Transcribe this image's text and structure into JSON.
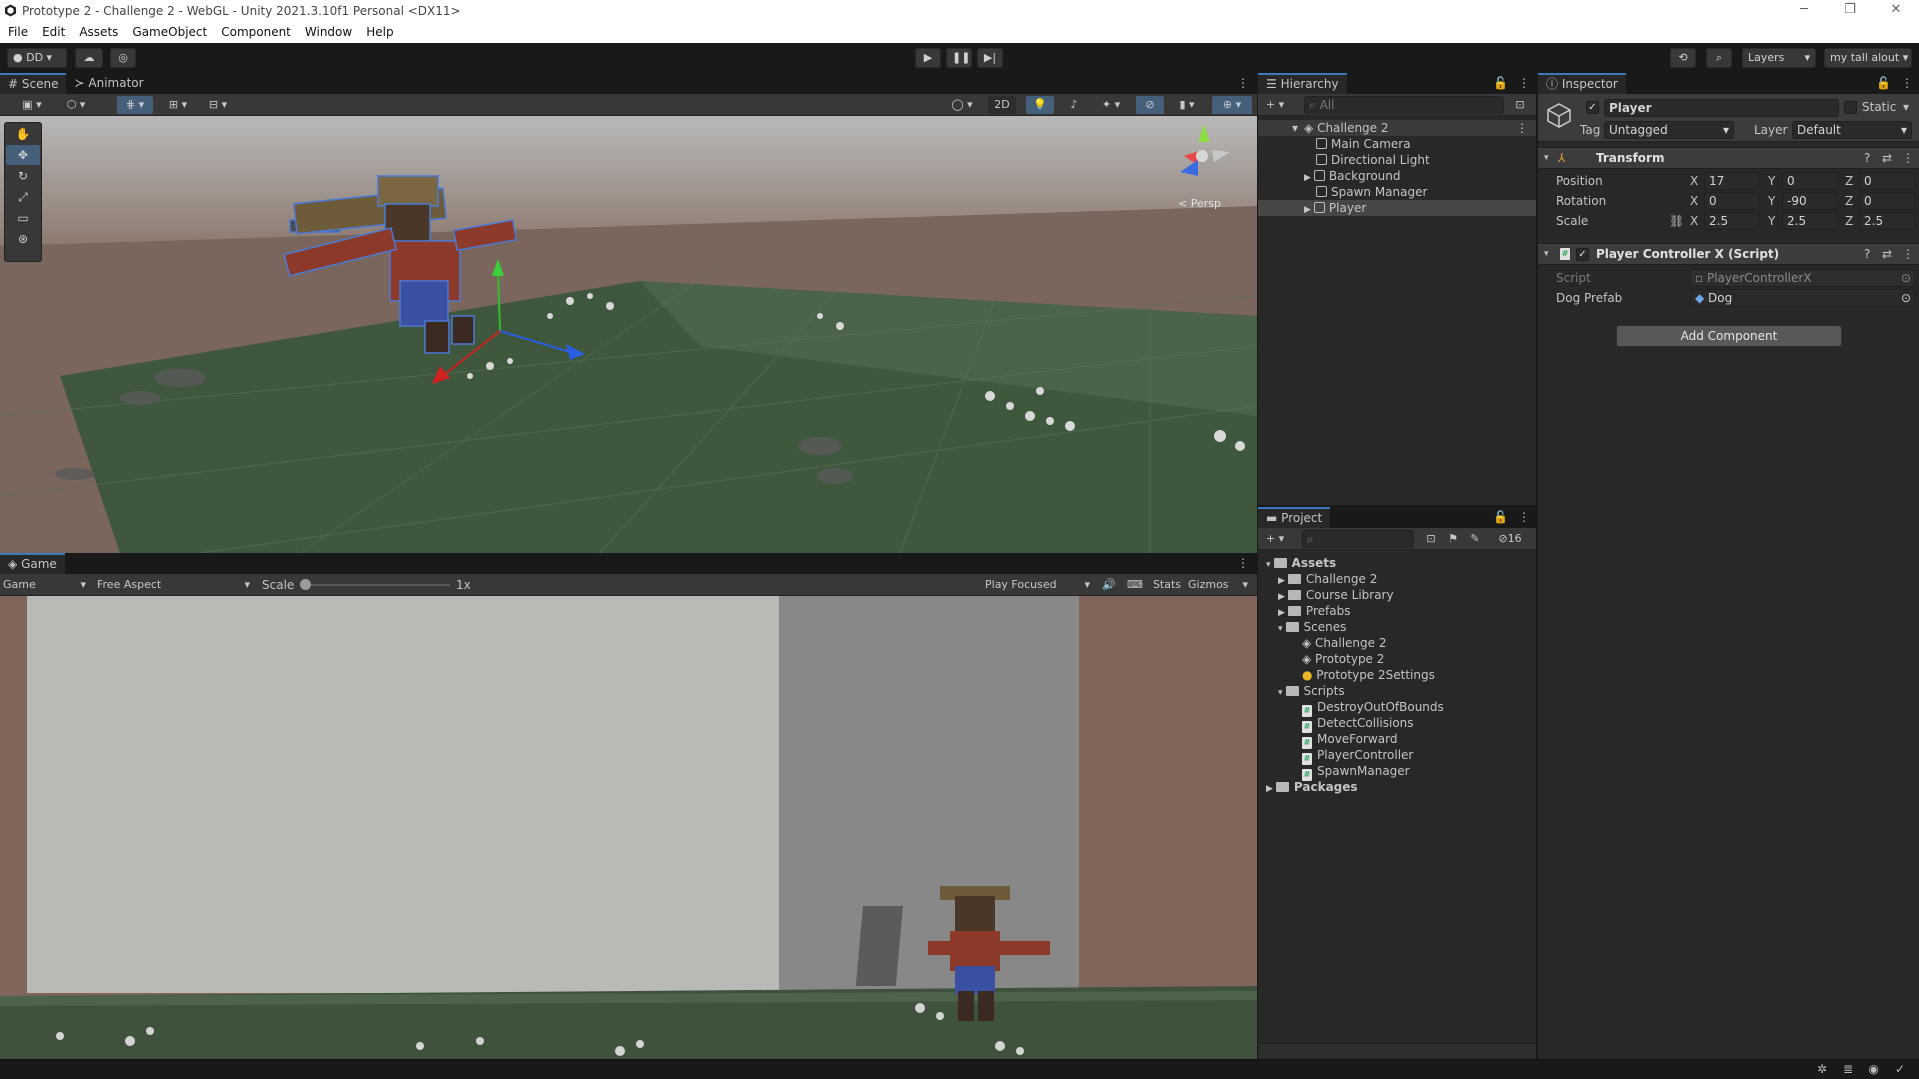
{
  "titlebar": {
    "title": "Prototype 2 - Challenge 2 - WebGL - Unity 2021.3.10f1 Personal <DX11>",
    "minimize": "─",
    "restore": "❐",
    "close": "✕"
  },
  "menu": [
    "File",
    "Edit",
    "Assets",
    "GameObject",
    "Component",
    "Window",
    "Help"
  ],
  "toolbar": {
    "account": "DD",
    "layers": "Layers",
    "layout": "my tall alout"
  },
  "scene": {
    "tabs": [
      "Scene",
      "Animator"
    ],
    "mode_2d": "2D",
    "persp": "< Persp"
  },
  "game": {
    "tab": "Game",
    "display": "Game",
    "aspect": "Free Aspect",
    "scale_label": "Scale",
    "scale_value": "1x",
    "play_mode": "Play Focused",
    "stats": "Stats",
    "gizmos": "Gizmos"
  },
  "hierarchy": {
    "tab": "Hierarchy",
    "search_placeholder": "All",
    "scene": "Challenge 2",
    "items": [
      "Main Camera",
      "Directional Light",
      "Background",
      "Spawn Manager",
      "Player"
    ]
  },
  "project": {
    "tab": "Project",
    "hidden_count": "16",
    "assets": "Assets",
    "folders": [
      "Challenge 2",
      "Course Library",
      "Prefabs",
      "Scenes"
    ],
    "scenes": [
      "Challenge 2",
      "Prototype 2",
      "Prototype 2Settings"
    ],
    "scripts_folder": "Scripts",
    "scripts": [
      "DestroyOutOfBounds",
      "DetectCollisions",
      "MoveForward",
      "PlayerController",
      "SpawnManager"
    ],
    "packages": "Packages"
  },
  "inspector": {
    "tab": "Inspector",
    "object_name": "Player",
    "static_label": "Static",
    "tag_label": "Tag",
    "tag_value": "Untagged",
    "layer_label": "Layer",
    "layer_value": "Default",
    "transform": {
      "title": "Transform",
      "position_label": "Position",
      "rotation_label": "Rotation",
      "scale_label": "Scale",
      "axis_x": "X",
      "axis_y": "Y",
      "axis_z": "Z",
      "position": [
        "17",
        "0",
        "0"
      ],
      "rotation": [
        "0",
        "-90",
        "0"
      ],
      "scale": [
        "2.5",
        "2.5",
        "2.5"
      ]
    },
    "script_component": {
      "title": "Player Controller X (Script)",
      "script_label": "Script",
      "script_value": "PlayerControllerX",
      "dog_label": "Dog Prefab",
      "dog_value": "Dog"
    },
    "add_component": "Add Component"
  },
  "colors": {
    "accent": "#3a79bb",
    "panel": "#282828",
    "header": "#383838"
  }
}
